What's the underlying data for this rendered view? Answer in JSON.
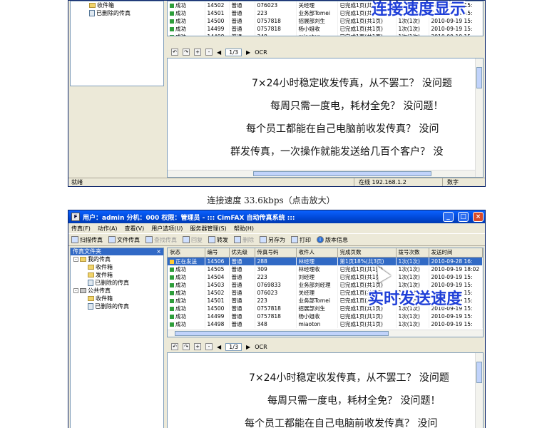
{
  "window1": {
    "tree_items": [
      "收件箱",
      "已删除的传真"
    ],
    "rows": [
      {
        "status": "成功",
        "id": "14502",
        "level": "普通",
        "number": "076023",
        "recipient": "关经理",
        "progress": "已完成1页(共1页)",
        "dials": "1次(1次)",
        "time": "2010-09-19 15:"
      },
      {
        "status": "成功",
        "id": "14501",
        "level": "普通",
        "number": "223",
        "recipient": "业务部Tomei",
        "progress": "已完成1页(共1页)",
        "dials": "1次(1次)",
        "time": "2010-09-19 15:"
      },
      {
        "status": "成功",
        "id": "14500",
        "level": "普通",
        "number": "0757818",
        "recipient": "招展部刘生",
        "progress": "已完成1页(共1页)",
        "dials": "1次(1次)",
        "time": "2010-09-19 15:"
      },
      {
        "status": "成功",
        "id": "14499",
        "level": "普通",
        "number": "0757818",
        "recipient": "杨小姐收",
        "progress": "已完成1页(共1页)",
        "dials": "1次(1次)",
        "time": "2010-09-19 15:"
      },
      {
        "status": "成功",
        "id": "14498",
        "level": "普通",
        "number": "348",
        "recipient": "miaoton",
        "progress": "已完成1页(共1页)",
        "dials": "1次(1次)",
        "time": "2010-09-19 15:"
      }
    ],
    "overlay": "连接速度显示",
    "page": "1/3",
    "ocr": "OCR",
    "doc_lines": [
      "7×24小时稳定收发传真，从不罢工？  没问题",
      "每周只需一度电，耗材全免？  没问题！",
      "每个员工都能在自己电脑前收发传真？  没问",
      "群发传真，一次操作就能发送给几百个客户？  没"
    ],
    "status_left": "就绪",
    "status_online": "在线 192.168.1.2",
    "status_num": "数字"
  },
  "caption": "连接速度 33.6kbps（点击放大）",
  "window2": {
    "title": "用户：admin  分机：000  权限：管理员 - ::: CimFAX 自动传真系统 :::",
    "menu": [
      "传真(F)",
      "动作(A)",
      "查看(V)",
      "用户选项(U)",
      "服务器管理(S)",
      "帮助(H)"
    ],
    "toolbar": [
      {
        "label": "扫描传真",
        "enabled": true
      },
      {
        "label": "文件传真",
        "enabled": true
      },
      {
        "label": "查找传真",
        "enabled": false
      },
      {
        "label": "回复",
        "enabled": false
      },
      {
        "label": "转发",
        "enabled": true
      },
      {
        "label": "删除",
        "enabled": false
      },
      {
        "label": "另存为",
        "enabled": true
      },
      {
        "label": "打印",
        "enabled": true
      },
      {
        "label": "版本信息",
        "enabled": true
      }
    ],
    "tree_header": "传真文件夹",
    "tree": {
      "my_fax": "我的传真",
      "my_children": [
        "收件箱",
        "发件箱",
        "已删除的传真"
      ],
      "public_fax": "公共传真",
      "public_children": [
        "收件箱",
        "已删除的传真"
      ]
    },
    "columns": [
      "状态",
      "编号",
      "优先级",
      "传真号码",
      "收件人",
      "完成页数",
      "拨号次数",
      "发送时间"
    ],
    "rows": [
      {
        "status": "正在发送",
        "id": "14506",
        "level": "普通",
        "number": "288",
        "recipient": "林经理",
        "progress": "第1页18%(共3页)",
        "dials": "1次(1次)",
        "time": "2010-09-28 16:",
        "selected": true
      },
      {
        "status": "成功",
        "id": "14505",
        "level": "普通",
        "number": "309",
        "recipient": "林经理收",
        "progress": "已完成1页(共1页)",
        "dials": "1次(1次)",
        "time": "2010-09-19 18:02"
      },
      {
        "status": "成功",
        "id": "14504",
        "level": "普通",
        "number": "223",
        "recipient": "刘经理",
        "progress": "已完成1页(共1页)",
        "dials": "1次(1次)",
        "time": "2010-09-19 15:"
      },
      {
        "status": "成功",
        "id": "14503",
        "level": "普通",
        "number": "0769833",
        "recipient": "业务部刘经理",
        "progress": "已完成1页(共1页)",
        "dials": "1次(1次)",
        "time": "2010-09-19 15:"
      },
      {
        "status": "成功",
        "id": "14502",
        "level": "普通",
        "number": "076023",
        "recipient": "关经理",
        "progress": "已完成1页(共1页)",
        "dials": "1次(1次)",
        "time": "2010-09-19 15:"
      },
      {
        "status": "成功",
        "id": "14501",
        "level": "普通",
        "number": "223",
        "recipient": "业务部Tomei",
        "progress": "已完成1页(共1页)",
        "dials": "1次(1次)",
        "time": "2010-09-19 15:"
      },
      {
        "status": "成功",
        "id": "14500",
        "level": "普通",
        "number": "0757818",
        "recipient": "招展部刘生",
        "progress": "已完成1页(共1页)",
        "dials": "1次(1次)",
        "time": "2010-09-19 15:"
      },
      {
        "status": "成功",
        "id": "14499",
        "level": "普通",
        "number": "0757818",
        "recipient": "杨小姐收",
        "progress": "已完成1页(共1页)",
        "dials": "1次(1次)",
        "time": "2010-09-19 15:"
      },
      {
        "status": "成功",
        "id": "14498",
        "level": "普通",
        "number": "348",
        "recipient": "miaoton",
        "progress": "已完成1页(共1页)",
        "dials": "1次(1次)",
        "time": "2010-09-19 15:"
      }
    ],
    "overlay": "实时发送速度",
    "page": "1/3",
    "ocr": "OCR",
    "doc_lines": [
      "7×24小时稳定收发传真，从不罢工？  没问题",
      "每周只需一度电，耗材全免？  没问题！",
      "每个员工都能在自己电脑前收发传真？  没问"
    ]
  },
  "colors": {
    "accent": "#0054e3",
    "selection": "#316ac5",
    "overlay_text": "#1f3fd8"
  }
}
